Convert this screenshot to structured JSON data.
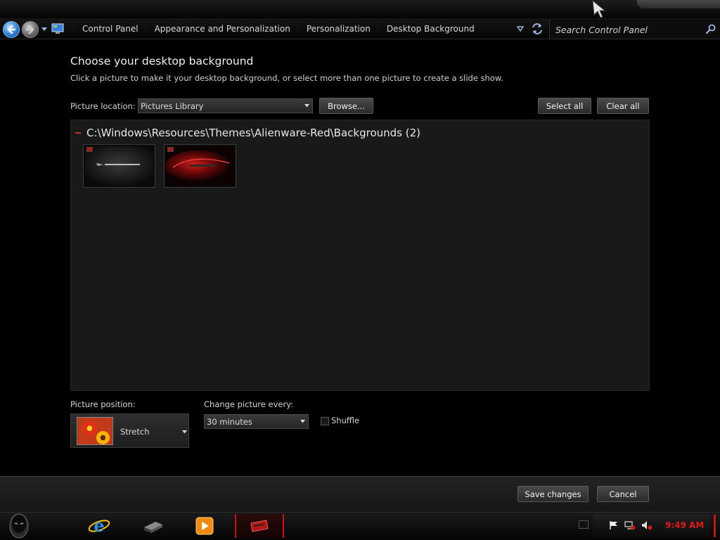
{
  "address_bar": {
    "breadcrumbs": [
      "Control Panel",
      "Appearance and Personalization",
      "Personalization",
      "Desktop Background"
    ],
    "search_placeholder": "Search Control Panel"
  },
  "main": {
    "title": "Choose your desktop background",
    "subtitle": "Click a picture to make it your desktop background, or select more than one picture to create a slide show.",
    "picture_location_label": "Picture location:",
    "picture_location_value": "Pictures Library",
    "browse_button": "Browse...",
    "select_all_button": "Select all",
    "clear_all_button": "Clear all",
    "group_header": "C:\\Windows\\Resources\\Themes\\Alienware-Red\\Backgrounds (2)",
    "thumbnails": [
      {
        "name": "alienware-dark-wallpaper",
        "selected": true
      },
      {
        "name": "alienware-red-wallpaper",
        "selected": true
      }
    ],
    "picture_position_label": "Picture position:",
    "picture_position_value": "Stretch",
    "change_picture_label": "Change picture every:",
    "change_picture_value": "30 minutes",
    "shuffle_label": "Shuffle",
    "shuffle_checked": false
  },
  "footer": {
    "save_button": "Save changes",
    "cancel_button": "Cancel"
  },
  "taskbar": {
    "clock": "9:49 AM",
    "accent_color": "#c41414"
  }
}
